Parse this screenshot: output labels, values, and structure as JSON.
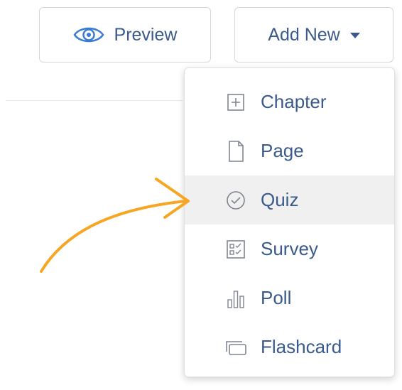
{
  "toolbar": {
    "preview_label": "Preview",
    "add_new_label": "Add New"
  },
  "menu": {
    "items": [
      {
        "label": "Chapter",
        "icon": "plus-square-icon"
      },
      {
        "label": "Page",
        "icon": "page-icon"
      },
      {
        "label": "Quiz",
        "icon": "check-circle-icon",
        "highlighted": true
      },
      {
        "label": "Survey",
        "icon": "survey-checklist-icon"
      },
      {
        "label": "Poll",
        "icon": "bar-chart-icon"
      },
      {
        "label": "Flashcard",
        "icon": "flashcard-icon"
      }
    ]
  },
  "colors": {
    "text": "#3a5a8c",
    "icon": "#7f8590",
    "highlight": "#f0f0f0",
    "arrow": "#f6a623"
  }
}
